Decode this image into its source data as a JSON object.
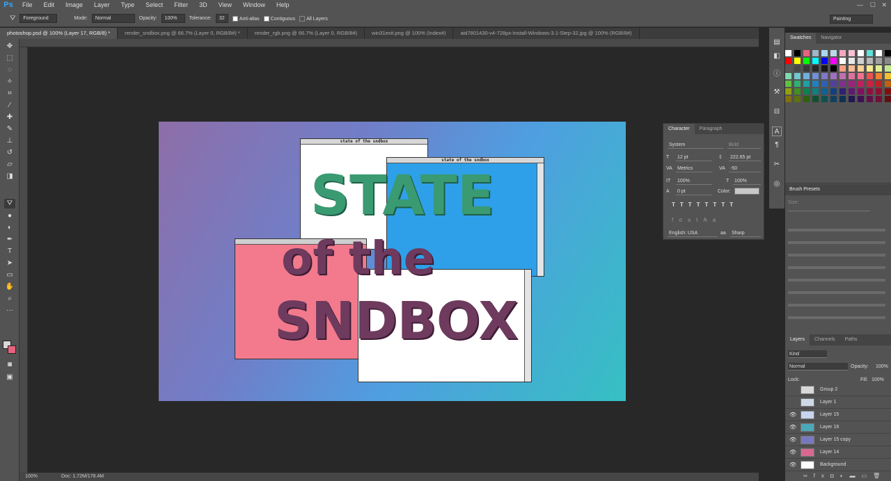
{
  "menubar": {
    "logo": "Ps",
    "items": [
      "File",
      "Edit",
      "Image",
      "Layer",
      "Type",
      "Select",
      "Filter",
      "3D",
      "View",
      "Window",
      "Help"
    ]
  },
  "options": {
    "fill_source": "Foreground",
    "mode_label": "Mode:",
    "mode_value": "Normal",
    "opacity_label": "Opacity:",
    "opacity_value": "100%",
    "tolerance_label": "Tolerance:",
    "tolerance_value": "32",
    "antialias_label": "Anti-alias",
    "contiguous_label": "Contiguous",
    "all_layers_label": "All Layers",
    "workspace": "Painting"
  },
  "tabs": [
    {
      "label": "photoshop.psd @ 100% (Layer 17, RGB/8) *",
      "active": true
    },
    {
      "label": "render_sndbox.png @ 66.7% (Layer 0, RGB/8#) *",
      "active": false
    },
    {
      "label": "render_rgb.png @ 66.7% (Layer 0, RGB/8#)",
      "active": false
    },
    {
      "label": "win31exit.png @ 100% (Index#)",
      "active": false
    },
    {
      "label": "aid7801430-v4-728px-Install-Windows-3.1-Step-32.jpg @ 100% (RGB/8#)",
      "active": false
    }
  ],
  "canvas": {
    "window1_title": "state of the sndbox",
    "window2_title": "state of the sndbox",
    "line1": "STATE",
    "line2": "of the",
    "line3": "SNDBOX"
  },
  "status": {
    "zoom": "100%",
    "doc": "Doc: 1.72M/178.4M"
  },
  "character": {
    "tab_character": "Character",
    "tab_paragraph": "Paragraph",
    "font_family": "System",
    "font_style": "Bold",
    "font_size": "12 pt",
    "leading": "222.65 pt",
    "kerning": "Metrics",
    "tracking": "-50",
    "vscale": "100%",
    "hscale": "100%",
    "baseline": "0 pt",
    "color_label": "Color:",
    "language": "English: USA",
    "aa_label": "aa",
    "antialias": "Sharp"
  },
  "swatches": {
    "tab_swatches": "Swatches",
    "tab_navigator": "Navigator",
    "colors": [
      "#ffffff",
      "#000000",
      "#e8637f",
      "#9fb5c8",
      "#a8d8f0",
      "#bcd8e8",
      "#f4a8c0",
      "#f8c0d0",
      "#ffffff",
      "#60e0d8",
      "#ffffff",
      "#000000",
      "#ffffff",
      "#ff0000",
      "#ffff00",
      "#00ff00",
      "#00ffff",
      "#0000ff",
      "#ff00ff",
      "#ffffff",
      "#e8e8e8",
      "#d0d0d0",
      "#b8b8b8",
      "#a0a0a0",
      "#888888",
      "#707070",
      "#585858",
      "#484848",
      "#383838",
      "#282828",
      "#181818",
      "#000000",
      "#f8a080",
      "#f8b890",
      "#f8d090",
      "#f8e890",
      "#e0f090",
      "#c0e890",
      "#a0e0a0",
      "#80d8b0",
      "#70c8d0",
      "#70b0e0",
      "#7090d8",
      "#8078c8",
      "#a070c0",
      "#c070b0",
      "#e070a0",
      "#f0708a",
      "#f05050",
      "#f08030",
      "#f0c030",
      "#c0d030",
      "#60c040",
      "#30b070",
      "#20a0a0",
      "#2080c0",
      "#3060b0",
      "#5040a0",
      "#803090",
      "#a02080",
      "#c02060",
      "#d02040",
      "#c02020",
      "#c06010",
      "#c0a010",
      "#90a010",
      "#409020",
      "#108050",
      "#108080",
      "#106090",
      "#104080",
      "#302070",
      "#601870",
      "#801060",
      "#901040",
      "#901030",
      "#801010",
      "#805010",
      "#807010",
      "#607010",
      "#306010",
      "#105030",
      "#105050",
      "#104060",
      "#103050",
      "#201850",
      "#401050",
      "#601048",
      "#701038",
      "#601010",
      "#a08060"
    ]
  },
  "brush_presets": {
    "title": "Brush Presets",
    "size_label": "Size:"
  },
  "layers": {
    "tab_layers": "Layers",
    "tab_channels": "Channels",
    "tab_paths": "Paths",
    "filter_kind": "Kind",
    "blend_mode": "Normal",
    "opacity_label": "Opacity:",
    "opacity_value": "100%",
    "lock_label": "Lock:",
    "fill_label": "Fill:",
    "fill_value": "100%",
    "items": [
      {
        "name": "Group 2",
        "visible": false,
        "thumb": "#d8d8d8"
      },
      {
        "name": "Layer 1",
        "visible": false,
        "thumb": "#cfd8e8"
      },
      {
        "name": "Layer 15",
        "visible": true,
        "thumb": "#c8d4f0"
      },
      {
        "name": "Layer 16",
        "visible": true,
        "thumb": "#4aa8b8"
      },
      {
        "name": "Layer 15 copy",
        "visible": true,
        "thumb": "#7878c0"
      },
      {
        "name": "Layer 14",
        "visible": true,
        "thumb": "#d86890"
      },
      {
        "name": "Background",
        "visible": true,
        "thumb": "#ffffff"
      }
    ]
  }
}
